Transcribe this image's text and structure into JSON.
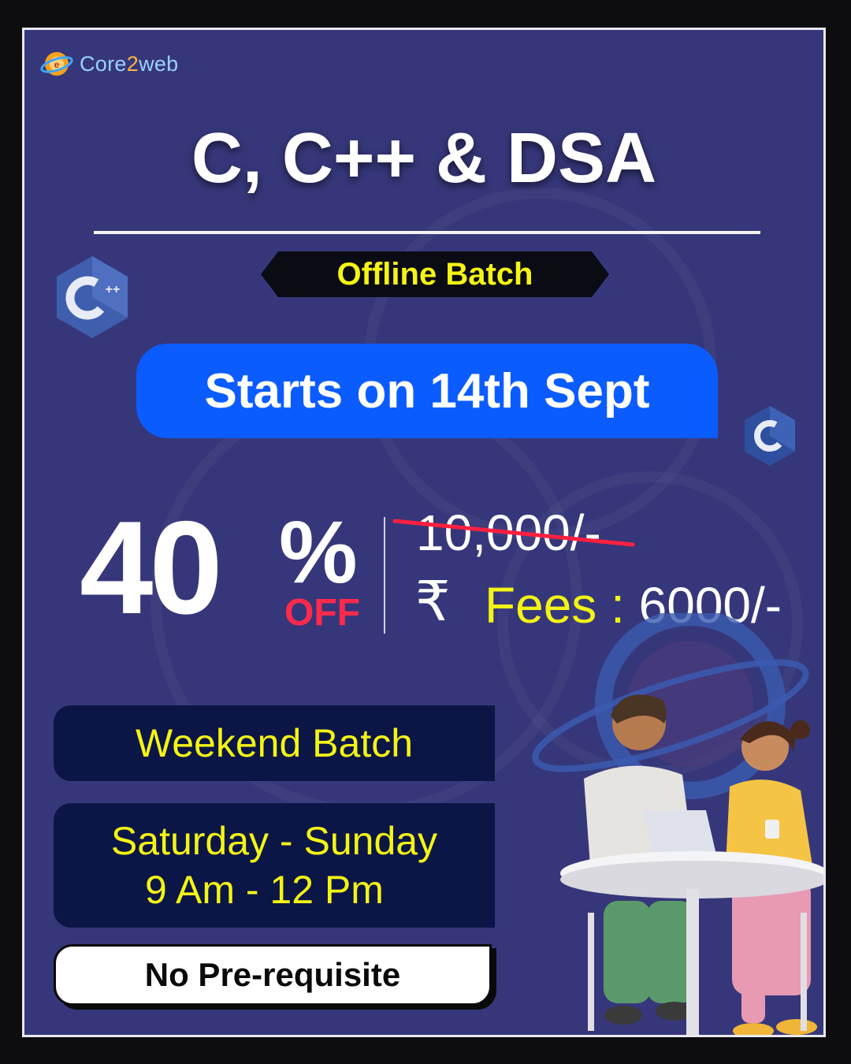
{
  "brand": {
    "name_part1": "Core",
    "name_part2": "2",
    "name_part3": "web",
    "icon": "core2web-logo-icon"
  },
  "title": "C, C++ & DSA",
  "mode_badge": "Offline Batch",
  "start_banner": "Starts on 14th Sept",
  "discount": {
    "value": "40",
    "percent_sign": "%",
    "off_label": "OFF"
  },
  "pricing": {
    "original_price": "10,000/-",
    "currency_symbol": "₹",
    "fees_label": "Fees : ",
    "fees_value": "6000/-"
  },
  "batch_type": "Weekend Batch",
  "schedule": {
    "days": "Saturday - Sunday",
    "time": "9 Am - 12 Pm"
  },
  "requirement": "No Pre-requisite",
  "icons": {
    "cpp": "cpp-logo-icon",
    "c": "c-logo-icon",
    "illustration": "students-at-table-illustration"
  },
  "colors": {
    "background": "#36377a",
    "accent_yellow": "#f4f415",
    "banner_blue": "#0b5cff",
    "off_red": "#ff2a4b",
    "panel_navy": "#0b1647"
  }
}
